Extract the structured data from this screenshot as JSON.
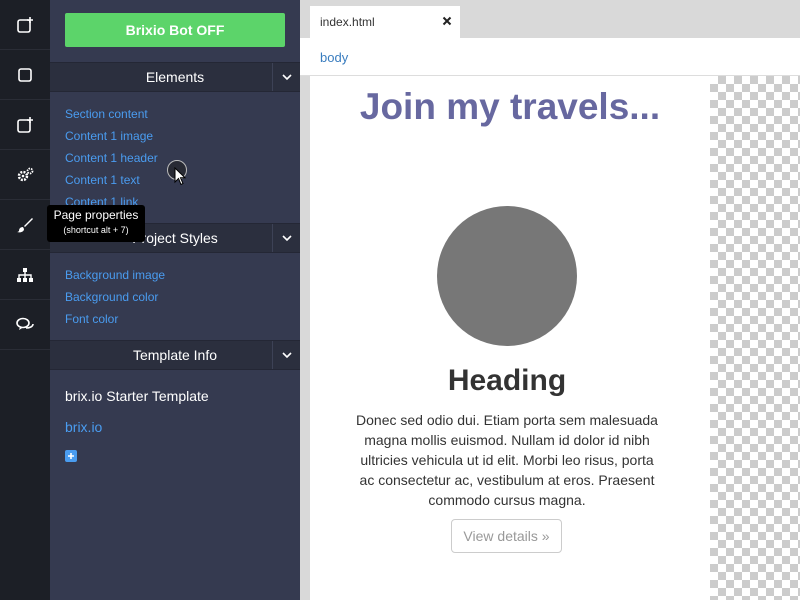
{
  "rail": {
    "icons": [
      "new-page-icon",
      "square-icon",
      "new-element-icon",
      "gears-icon",
      "brush-icon",
      "sitemap-icon",
      "chat-icon"
    ]
  },
  "panel": {
    "bot_button": "Brixio Bot OFF",
    "elements": {
      "title": "Elements",
      "items": [
        "Section content",
        "Content 1 image",
        "Content 1 header",
        "Content 1 text",
        "Content 1 link"
      ]
    },
    "project_styles": {
      "title": "Project Styles",
      "items": [
        "Background image",
        "Background color",
        "Font color"
      ]
    },
    "template_info": {
      "title": "Template Info",
      "name": "brix.io Starter Template",
      "link": "brix.io"
    }
  },
  "tooltip": {
    "title": "Page properties",
    "shortcut": "(shortcut alt + 7)"
  },
  "editor": {
    "tab_label": "index.html",
    "breadcrumb": "body"
  },
  "page": {
    "title": "Join my travels...",
    "heading": "Heading",
    "body": "Donec sed odio dui. Etiam porta sem malesuada magna mollis euismod. Nullam id dolor id nibh ultricies vehicula ut id elit. Morbi leo risus, porta ac consectetur ac, vestibulum at eros. Praesent commodo cursus magna.",
    "button": "View details »"
  },
  "colors": {
    "accent_green": "#5cd46a",
    "link_blue": "#4a9cf0",
    "title_purple": "#6768a0"
  }
}
